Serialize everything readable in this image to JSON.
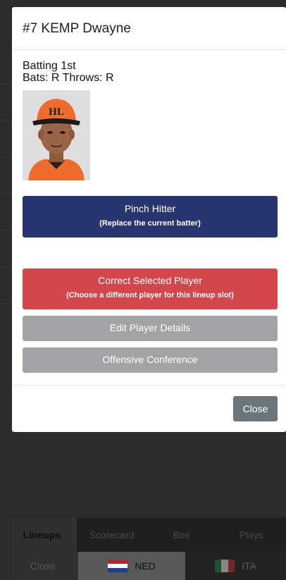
{
  "modal": {
    "title": "#7 KEMP Dwayne",
    "batting": "Batting 1st",
    "bats_throws": "Bats: R Throws: R",
    "buttons": {
      "pinch_hitter": {
        "label": "Pinch Hitter",
        "sub": "(Replace the current batter)"
      },
      "correct_player": {
        "label": "Correct Selected Player",
        "sub": "(Choose a different player for this lineup slot)"
      },
      "edit_details": {
        "label": "Edit Player Details"
      },
      "offensive_conference": {
        "label": "Offensive Conference"
      }
    },
    "close_label": "Close"
  },
  "tabs": [
    {
      "label": "Lineups",
      "active": true
    },
    {
      "label": "Scorecard",
      "active": false
    },
    {
      "label": "Box",
      "active": false
    },
    {
      "label": "Plays",
      "active": false
    }
  ],
  "bottom_bar": {
    "close_label": "Close",
    "team_ned": "NED",
    "team_ita": "ITA"
  },
  "colors": {
    "primary": "#27346f",
    "danger": "#d3474c",
    "secondary": "#a3a3a6",
    "close": "#6b757c"
  }
}
